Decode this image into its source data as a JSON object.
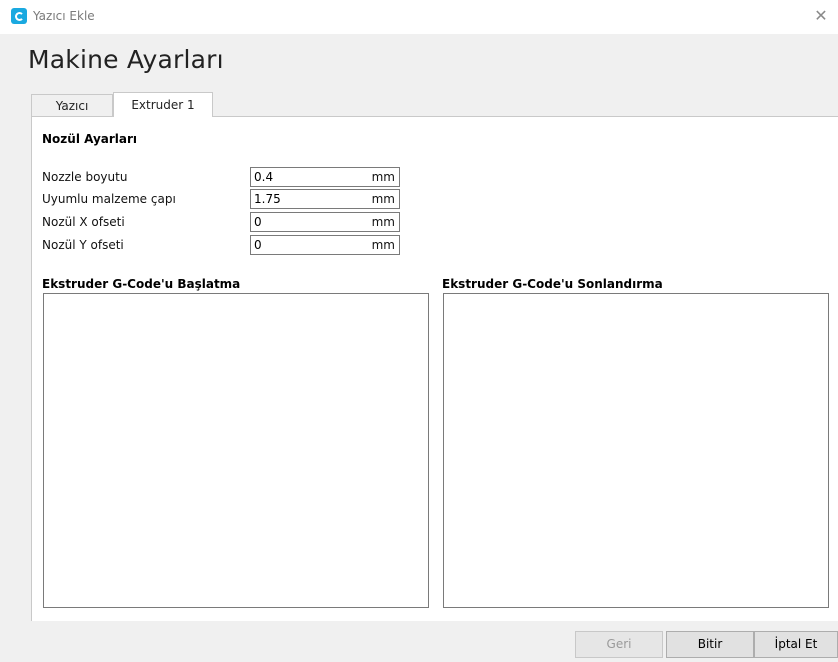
{
  "window": {
    "title": "Yazıcı Ekle",
    "close_symbol": "✕",
    "icon": "cura-logo-icon",
    "accent_color": "#1aa9e0"
  },
  "page": {
    "title": "Makine Ayarları"
  },
  "tabs": [
    {
      "label": "Yazıcı",
      "active": false
    },
    {
      "label": "Extruder 1",
      "active": true
    }
  ],
  "nozzle_settings": {
    "section_title": "Nozül Ayarları",
    "fields": [
      {
        "label": "Nozzle boyutu",
        "value": "0.4",
        "unit": "mm"
      },
      {
        "label": "Uyumlu malzeme çapı",
        "value": "1.75",
        "unit": "mm"
      },
      {
        "label": "Nozül X ofseti",
        "value": "0",
        "unit": "mm"
      },
      {
        "label": "Nozül Y ofseti",
        "value": "0",
        "unit": "mm"
      }
    ]
  },
  "gcode": {
    "start_title": "Ekstruder G-Code'u Başlatma",
    "start_value": "",
    "end_title": "Ekstruder G-Code'u Sonlandırma",
    "end_value": ""
  },
  "footer": {
    "back_label": "Geri",
    "back_enabled": false,
    "finish_label": "Bitir",
    "cancel_label": "İptal Et"
  }
}
